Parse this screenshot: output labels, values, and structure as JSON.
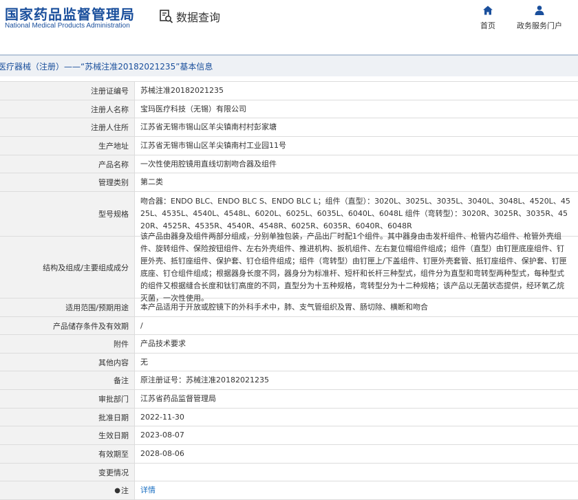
{
  "header": {
    "logo_cn": "国家药品监督管理局",
    "logo_en": "National Medical Products Administration",
    "query_title": "数据查询",
    "nav": {
      "home": "首页",
      "service": "政务服务门户"
    }
  },
  "page_title": "医疗器械（注册）——“苏械注准20182021235”基本信息",
  "rows": [
    {
      "label": "注册证编号",
      "value": "苏械注准20182021235"
    },
    {
      "label": "注册人名称",
      "value": "宝玛医疗科技（无锡）有限公司"
    },
    {
      "label": "注册人住所",
      "value": "江苏省无锡市锡山区羊尖镇南村村彭家塘"
    },
    {
      "label": "生产地址",
      "value": "江苏省无锡市锡山区羊尖镇南村工业园11号"
    },
    {
      "label": "产品名称",
      "value": "一次性使用腔镜用直线切割吻合器及组件"
    },
    {
      "label": "管理类别",
      "value": "第二类"
    },
    {
      "label": "型号规格",
      "value": "吻合器：ENDO BLC、ENDO BLC S、ENDO BLC L；组件（直型）：3020L、3025L、3035L、3040L、3048L、4520L、4525L、4535L、4540L、4548L、6020L、6025L、6035L、6040L、6048L 组件（弯转型）：3020R、3025R、3035R、4520R、4525R、4535R、4540R、4548R、6025R、6035R、6040R、6048R"
    },
    {
      "label": "结构及组成/主要组成成分",
      "value": "该产品由器身及组件两部分组成，分别单独包装，产品出厂时配1个组件。其中器身由击发杆组件、枪管内芯组件、枪管外壳组件、旋转组件、保险按钮组件、左右外壳组件、推进机构、扳机组件、左右复位帽组件组成；组件（直型）由钉匣底座组件、钉匣外壳、抵钉座组件、保护套、钉仓组件组成；组件（弯转型）由钉匣上/下盖组件、钉匣外壳套管、抵钉座组件、保护套、钉匣底座、钉仓组件组成；根据器身长度不同，器身分为标准杆、短杆和长杆三种型式，组件分为直型和弯转型两种型式，每种型式的组件又根据缝合长度和钛钉高度的不同，直型分为十五种规格，弯转型分为十二种规格；该产品以无菌状态提供，经环氧乙烷灭菌，一次性使用。"
    },
    {
      "label": "适用范围/预期用途",
      "value": "本产品适用于开放或腔镜下的外科手术中，肺、支气管组织及胃、肠切除、横断和吻合"
    },
    {
      "label": "产品储存条件及有效期",
      "value": "/"
    },
    {
      "label": "附件",
      "value": "产品技术要求"
    },
    {
      "label": "其他内容",
      "value": "无"
    },
    {
      "label": "备注",
      "value": "原注册证号：苏械注准20182021235"
    },
    {
      "label": "审批部门",
      "value": "江苏省药品监督管理局"
    },
    {
      "label": "批准日期",
      "value": "2022-11-30"
    },
    {
      "label": "生效日期",
      "value": "2023-08-07"
    },
    {
      "label": "有效期至",
      "value": "2028-08-06"
    },
    {
      "label": "变更情况",
      "value": ""
    }
  ],
  "note_row": {
    "label": "注",
    "pin_icon": "pin-icon",
    "link": "详情"
  },
  "colors": {
    "brand_blue": "#1a4f9c",
    "link_blue": "#1a6fc2",
    "label_bg": "#f2f2f2",
    "title_bg": "#eef1f5"
  }
}
